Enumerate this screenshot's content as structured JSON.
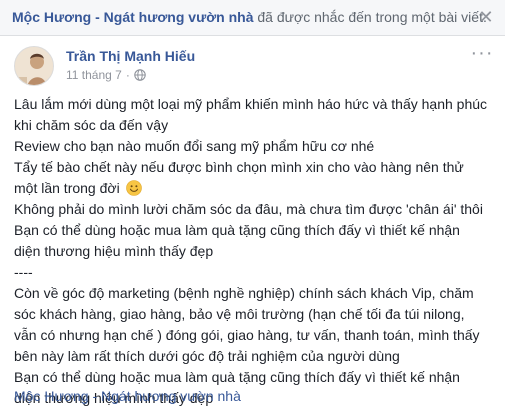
{
  "notification": {
    "page_name": "Mộc Hương",
    "separator": "-",
    "page_subtitle": "Ngát hương vườn nhà",
    "message": "đã được nhắc đến trong một bài viết."
  },
  "post": {
    "author": "Trần Thị Mạnh Hiếu",
    "date": "11 tháng 7",
    "privacy_icon": "globe-icon",
    "options_icon": "more-options-icon",
    "lines": [
      "Lâu lắm mới dùng một loại mỹ phẩm khiến mình háo hức và thấy hạnh phúc",
      "khi chăm sóc da đến vậy",
      "Review cho bạn nào muốn đổi sang mỹ phẩm hữu cơ nhé",
      "Tẩy tế bào chết này nếu được bình chọn mình xin cho vào hàng nên thử",
      "một lần trong đời",
      "Không phải do mình lười chăm sóc da đâu, mà chưa tìm được 'chân ái' thôi",
      "Bạn có thể dùng hoặc mua làm quà tặng cũng thích đấy vì thiết kế nhận",
      "diện thương hiệu mình thấy đẹp",
      "----",
      "Còn về góc độ marketing (bệnh nghề nghiệp) chính sách khách Vip, chăm",
      "sóc khách hàng, giao hàng, bảo vệ môi trường (hạn chế tối đa túi nilong,",
      "vẫn có nhưng hạn chế ) đóng gói, giao hàng, tư vấn, thanh toán, mình thấy",
      "bên này làm rất thích dưới góc độ trải nghiệm của người dùng",
      "Bạn có thể dùng hoặc mua làm quà tặng cũng thích đấy vì thiết kế nhận",
      "diện thương hiệu mình thấy đẹp"
    ],
    "emoji_after_line": 4,
    "emoji_icon": "smile-emoji-icon",
    "tag_page_name": "Mộc Hương",
    "tag_separator": "-",
    "tag_page_subtitle": "Ngát hương vườn nhà"
  },
  "colors": {
    "link": "#385898",
    "text": "#1d2129",
    "meta": "#90949c",
    "notif_bg": "#f6f7f9"
  }
}
